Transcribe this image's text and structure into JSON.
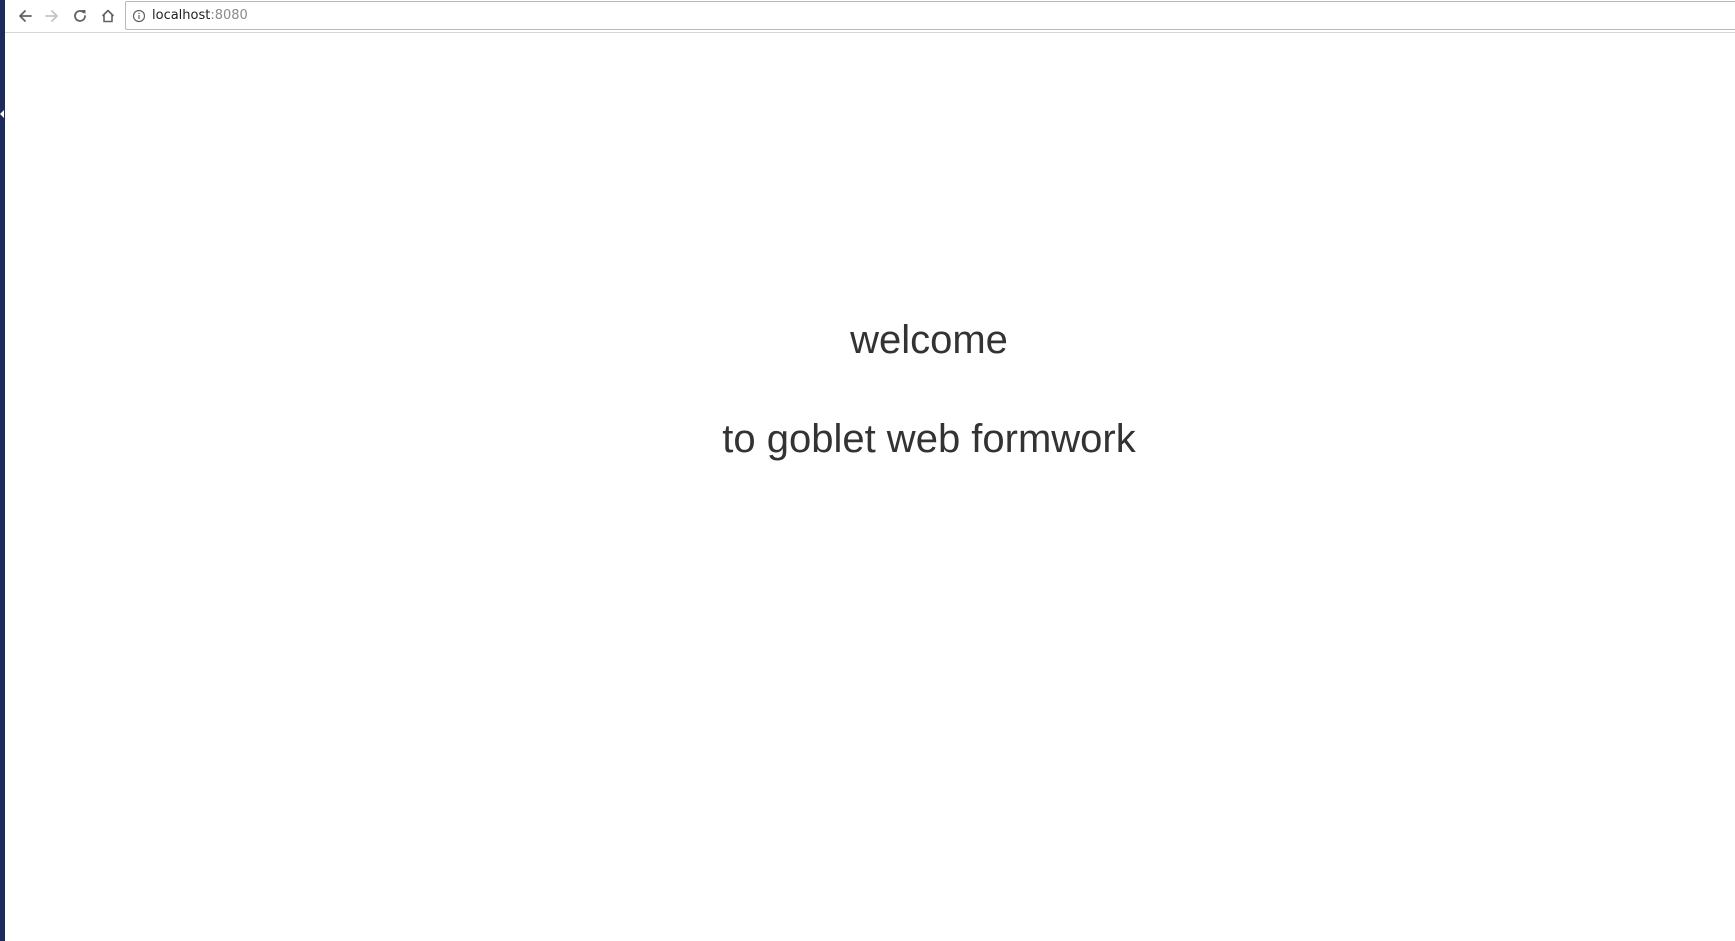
{
  "browser": {
    "url_host": "localhost",
    "url_port": ":8080",
    "icons": {
      "back": "arrow-left-icon",
      "forward": "arrow-right-icon",
      "reload": "reload-icon",
      "home": "home-icon",
      "site_info": "info-icon"
    },
    "forward_enabled": false
  },
  "page": {
    "heading_line_1": "welcome",
    "heading_line_2": "to goblet web formwork",
    "text_color": "#333333"
  }
}
